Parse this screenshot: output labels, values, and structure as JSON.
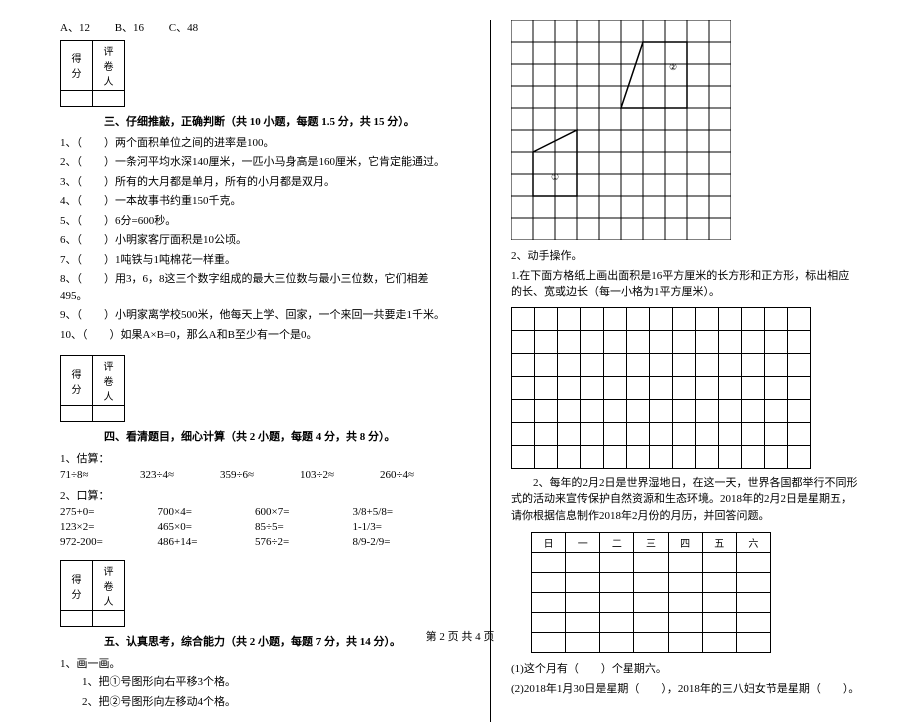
{
  "top_options": {
    "a": "A、12",
    "b": "B、16",
    "c": "C、48"
  },
  "scorebox": {
    "head1": "得分",
    "head2": "评卷人"
  },
  "section3": {
    "title": "三、仔细推敲，正确判断（共 10 小题，每题 1.5 分，共 15 分）。",
    "items": [
      "1、（　　）两个面积单位之间的进率是100。",
      "2、（　　）一条河平均水深140厘米，一匹小马身高是160厘米，它肯定能通过。",
      "3、（　　）所有的大月都是单月，所有的小月都是双月。",
      "4、（　　）一本故事书约重150千克。",
      "5、（　　）6分=600秒。",
      "6、（　　）小明家客厅面积是10公顷。",
      "7、（　　）1吨铁与1吨棉花一样重。",
      "8、（　　）用3，6，8这三个数字组成的最大三位数与最小三位数，它们相差495。",
      "9、（　　）小明家离学校500米，他每天上学、回家，一个来回一共要走1千米。",
      "10、（　　）如果A×B=0，那么A和B至少有一个是0。"
    ]
  },
  "section4": {
    "title": "四、看清题目，细心计算（共 2 小题，每题 4 分，共 8 分）。",
    "sub1_label": "1、估算：",
    "row1": [
      "71÷8≈",
      "323÷4≈",
      "359÷6≈",
      "103÷2≈",
      "260÷4≈"
    ],
    "sub2_label": "2、口算：",
    "row2": [
      "275+0=",
      "700×4=",
      "600×7=",
      "3/8+5/8="
    ],
    "row3": [
      "123×2=",
      "465×0=",
      "85÷5=",
      "1-1/3="
    ],
    "row4": [
      "972-200=",
      "486+14=",
      "576÷2=",
      "8/9-2/9="
    ]
  },
  "section5": {
    "title": "五、认真思考，综合能力（共 2 小题，每题 7 分，共 14 分）。",
    "sub1_label": "1、画一画。",
    "line1": "1、把①号图形向右平移3个格。",
    "line2": "2、把②号图形向左移动4个格。",
    "shape1_label": "①",
    "shape2_label": "②"
  },
  "right": {
    "hands_on": "2、动手操作。",
    "p1": "1.在下面方格纸上画出面积是16平方厘米的长方形和正方形，标出相应的长、宽或边长（每一小格为1平方厘米）。",
    "p2_prefix": "2、每年的2月2日是世界湿地日，在这一天，世界各国都举行不同形式的活动来宣传保护自然资源和生态环境。2018年的2月2日是星期五，请你根据信息制作2018年2月份的月历，并回答问题。",
    "calendar_head": [
      "日",
      "一",
      "二",
      "三",
      "四",
      "五",
      "六"
    ],
    "q_a": "(1)这个月有（　　）个星期六。",
    "q_b": "(2)2018年1月30日是星期（　　），2018年的三八妇女节是星期（　　）。"
  },
  "footer": "第 2 页 共 4 页"
}
